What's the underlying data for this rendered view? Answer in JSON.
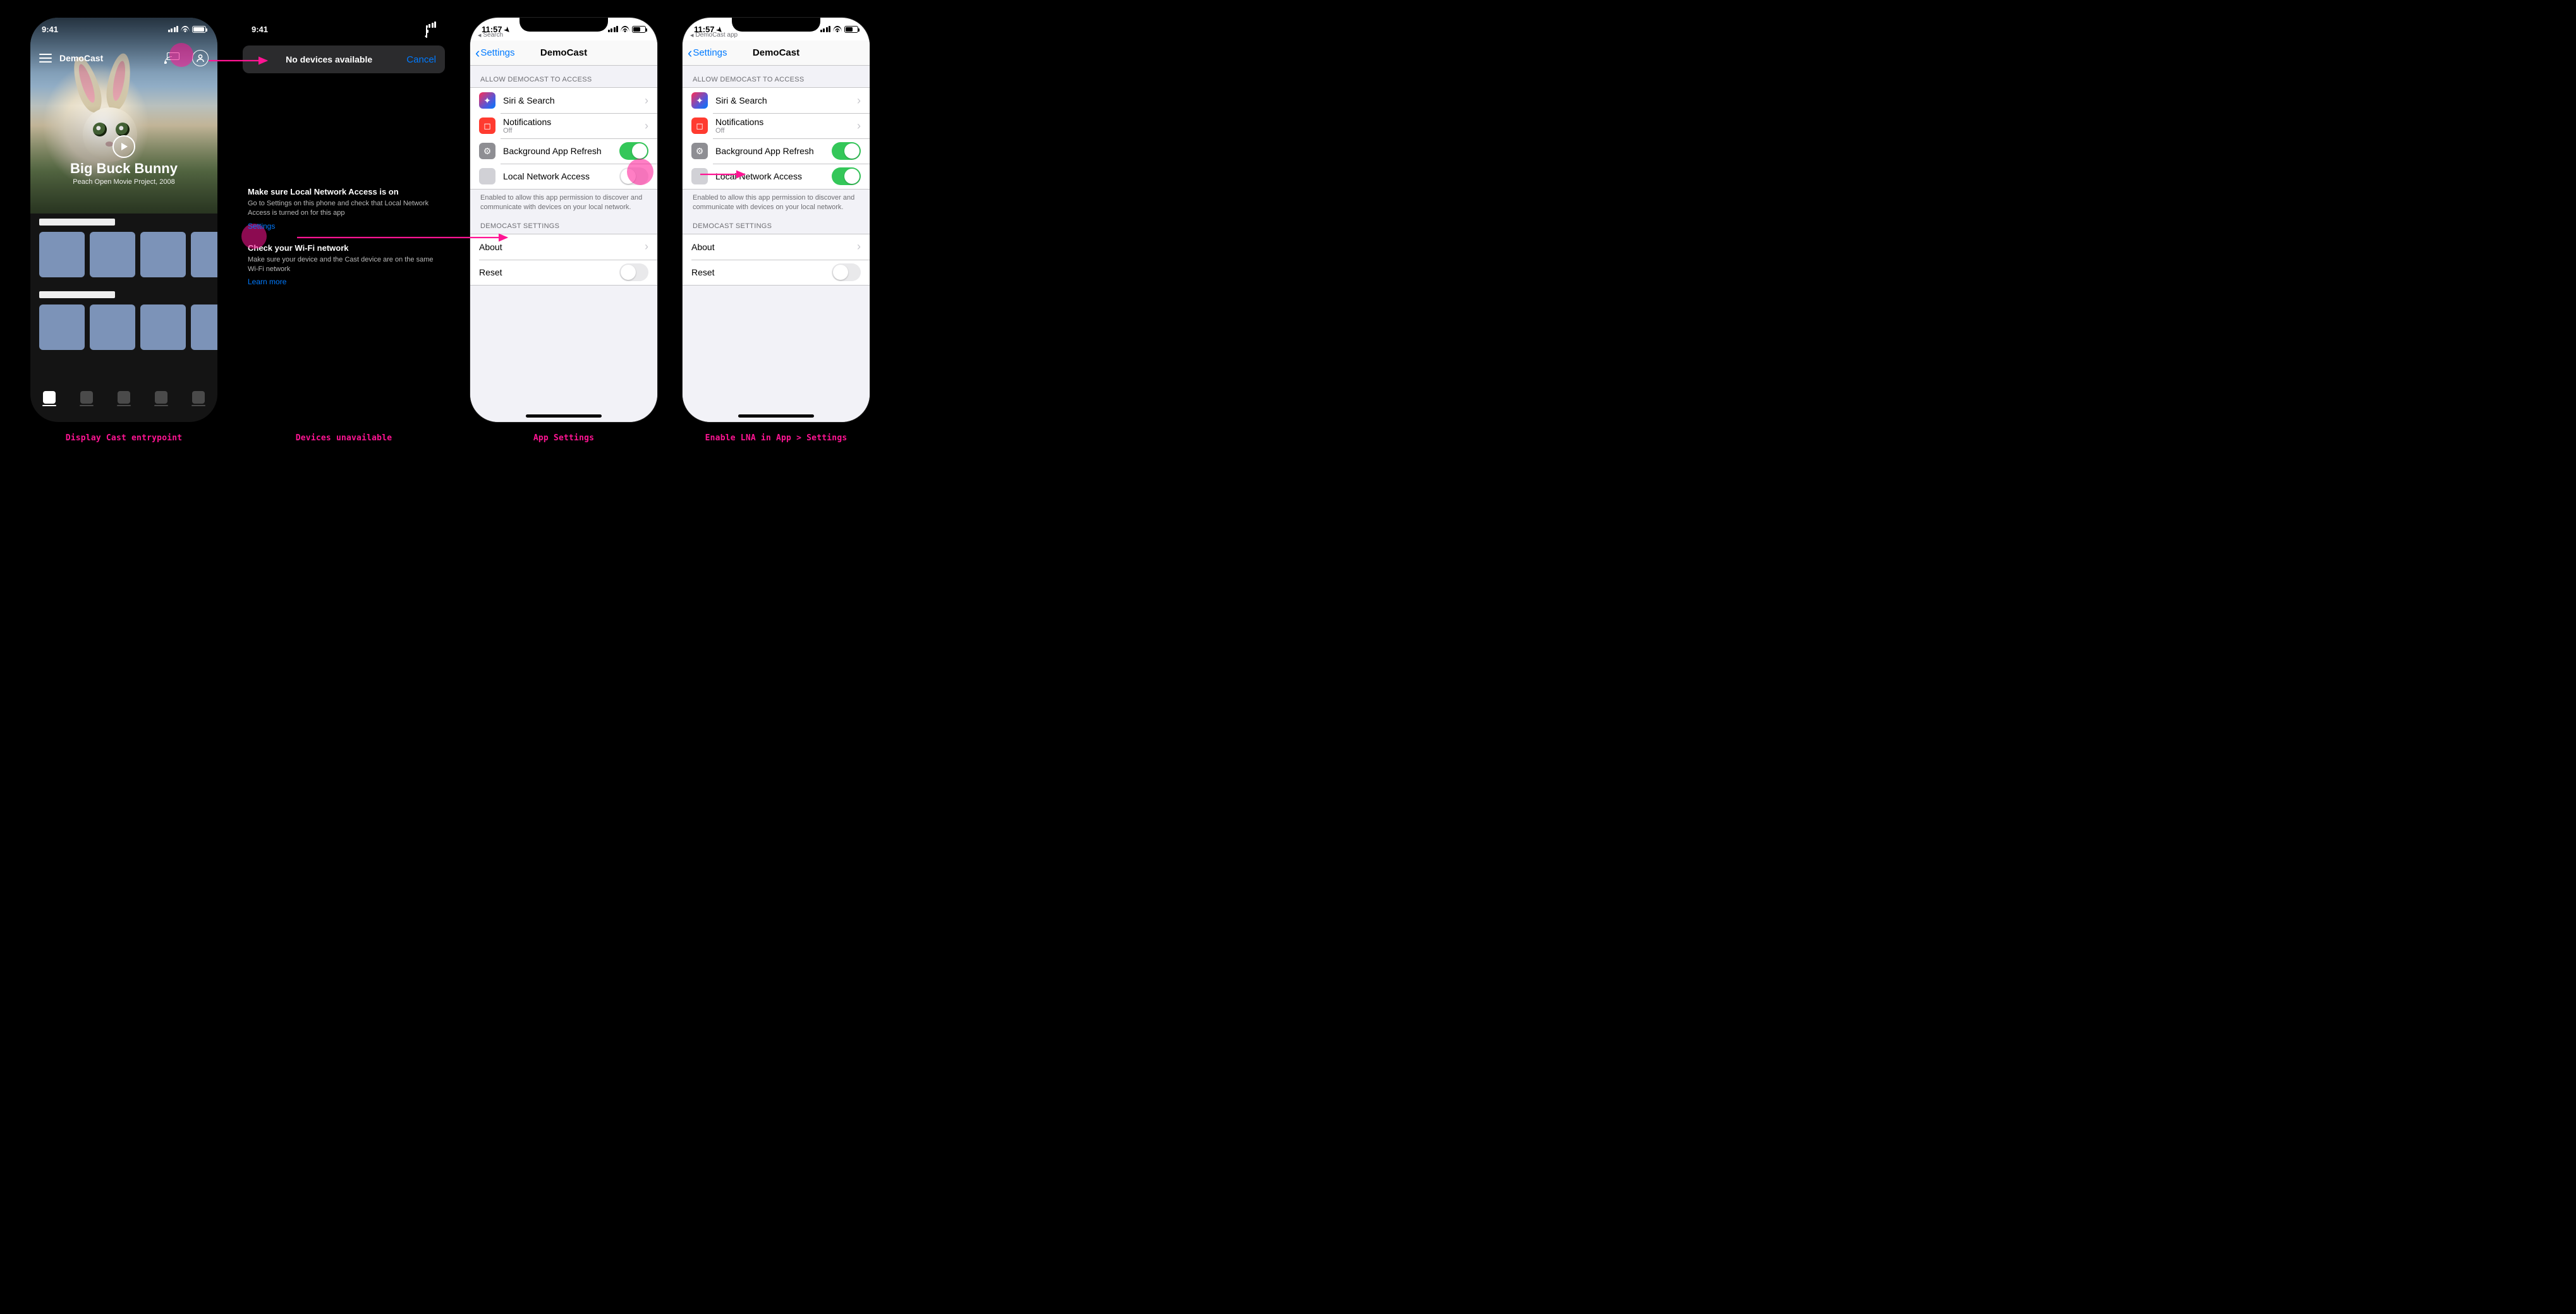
{
  "captions": {
    "c1": "Display Cast entrypoint",
    "c2": "Devices unavailable",
    "c3": "App Settings",
    "c4": "Enable LNA in App > Settings"
  },
  "status": {
    "t941": "9:41",
    "t1157": "11:57"
  },
  "crumbs": {
    "search": "Search",
    "democast_app": "DemoCast app"
  },
  "screen1": {
    "app_name": "DemoCast",
    "hero_title": "Big Buck Bunny",
    "hero_sub": "Peach Open Movie Project, 2008"
  },
  "screen2": {
    "bar_title": "No devices available",
    "cancel": "Cancel",
    "tip1_h": "Make sure Local Network Access is on",
    "tip1_p": "Go to Settings on this phone and check that Local Network Access is turned on for this app",
    "tip1_link": "Settings",
    "tip2_h": "Check your Wi-Fi network",
    "tip2_p": "Make sure your device and the Cast device are on the same Wi-Fi network",
    "tip2_link": "Learn more"
  },
  "settings": {
    "back": "Settings",
    "title": "DemoCast",
    "sect_access": "ALLOW DEMOCAST TO ACCESS",
    "siri": "Siri & Search",
    "notif": "Notifications",
    "notif_sub": "Off",
    "bgr": "Background App Refresh",
    "lna": "Local Network Access",
    "lna_foot": "Enabled to allow this app permission to discover and communicate with devices on your local network.",
    "sect_app": "DEMOCAST SETTINGS",
    "about": "About",
    "reset": "Reset"
  }
}
